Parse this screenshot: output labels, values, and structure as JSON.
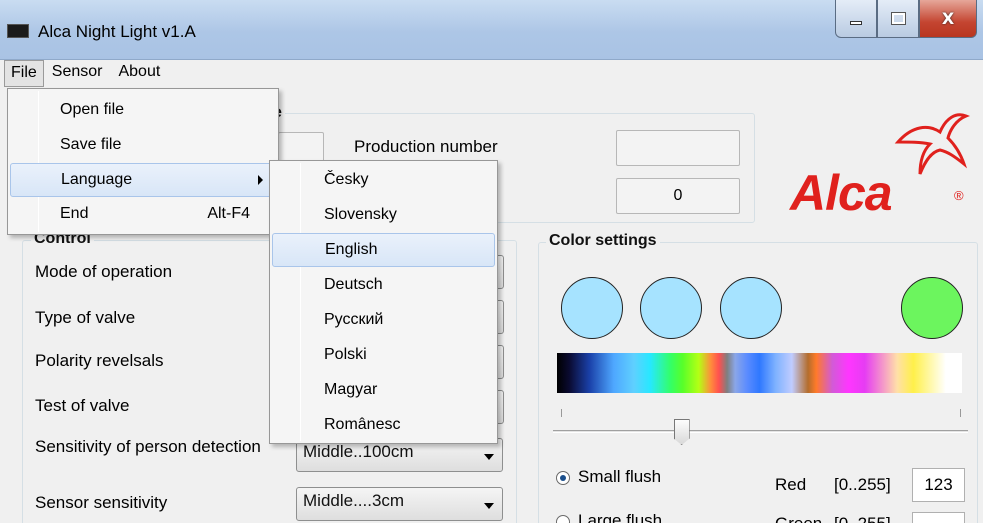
{
  "window": {
    "title": "Alca Night Light  v1.A",
    "buttons": {
      "minimize_icon": "minimize-icon",
      "maximize_icon": "maximize-icon",
      "close_glyph": "X"
    }
  },
  "menubar": {
    "file": "File",
    "sensor": "Sensor",
    "about": "About"
  },
  "file_menu": {
    "items": [
      {
        "label": "Open file",
        "shortcut": ""
      },
      {
        "label": "Save file",
        "shortcut": ""
      },
      {
        "label": "Language",
        "shortcut": ""
      },
      {
        "label": "End",
        "shortcut": "Alt-F4"
      }
    ]
  },
  "language_menu": {
    "items": [
      "Česky",
      "Slovensky",
      "English",
      "Deutsch",
      "Русский",
      "Polski",
      "Magyar",
      "Românesc"
    ],
    "highlighted": "English"
  },
  "info_group": {
    "title_fragment": "e",
    "production_number_label": "Production number",
    "production_number_value": "",
    "count_value": "0"
  },
  "logo": {
    "text": "Alca",
    "reg": "®"
  },
  "control": {
    "title": "Control",
    "labels": [
      "Mode of operation",
      "Type of valve",
      "Polarity revelsals",
      "Test of valve",
      "Sensitivity of person detection",
      "Sensor sensitivity"
    ],
    "person_detection_value": "Middle..100cm",
    "sensor_sensitivity_value": "Middle....3cm"
  },
  "color_settings": {
    "title": "Color settings",
    "circle_colors": [
      "#a6e3ff",
      "#a6e3ff",
      "#a6e3ff",
      "#6cf55e"
    ],
    "small_flush_label": "Small flush",
    "large_flush_label": "Large flush",
    "red_label": "Red",
    "range_label": "[0..255]",
    "red_value": "123",
    "green_label": "Green",
    "slider_position": 0.31
  }
}
